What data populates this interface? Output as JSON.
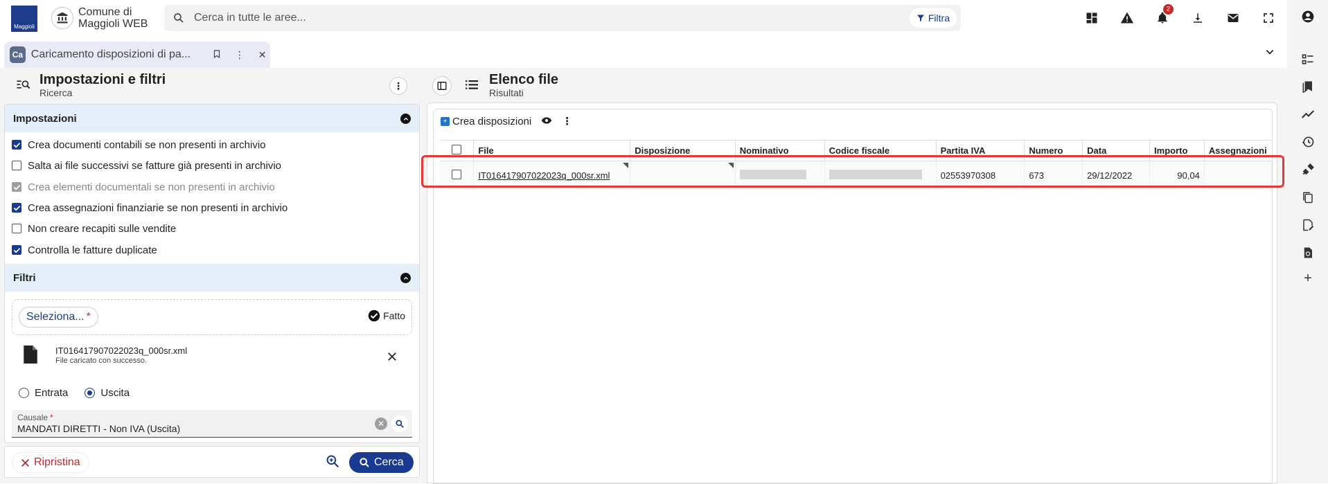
{
  "topbar": {
    "logo_text": "Maggioli",
    "org_name_line1": "Comune di",
    "org_name_line2": "Maggioli WEB",
    "search_placeholder": "Cerca in tutte le aree...",
    "filter_label": "Filtra",
    "notifications_count": "2"
  },
  "tab": {
    "icon_text": "Ca",
    "label": "Caricamento disposizioni di pa..."
  },
  "left": {
    "title": "Impostazioni e filtri",
    "subtitle": "Ricerca",
    "impostazioni": {
      "title": "Impostazioni",
      "options": [
        {
          "label": "Crea documenti contabili se non presenti in archivio",
          "checked": true,
          "disabled": false
        },
        {
          "label": "Salta ai file successivi se fatture già presenti in archivio",
          "checked": false,
          "disabled": false
        },
        {
          "label": "Crea elementi documentali se non presenti in archivio",
          "checked": true,
          "disabled": true
        },
        {
          "label": "Crea assegnazioni finanziarie se non presenti in archivio",
          "checked": true,
          "disabled": false
        },
        {
          "label": "Non creare recapiti sulle vendite",
          "checked": false,
          "disabled": false
        },
        {
          "label": "Controlla le fatture duplicate",
          "checked": true,
          "disabled": false
        }
      ]
    },
    "filtri": {
      "title": "Filtri",
      "select_label": "Seleziona...",
      "required_mark": "*",
      "done_label": "Fatto",
      "file_name": "IT016417907022023q_000sr.xml",
      "file_status": "File caricato con successo.",
      "radio_entrata": "Entrata",
      "radio_uscita": "Uscita",
      "selected_radio": "uscita",
      "causale_label": "Causale",
      "causale_value": "MANDATI DIRETTI - Non IVA (Uscita)"
    },
    "footer": {
      "reset_label": "Ripristina",
      "search_label": "Cerca"
    }
  },
  "right": {
    "title": "Elenco file",
    "subtitle": "Risultati",
    "toolbar": {
      "create_label": "Crea disposizioni"
    },
    "columns": [
      "File",
      "Disposizione",
      "Nominativo",
      "Codice fiscale",
      "Partita IVA",
      "Numero",
      "Data",
      "Importo",
      "Assegnazioni"
    ],
    "rows": [
      {
        "file": "IT016417907022023q_000sr.xml",
        "disposizione": "",
        "nominativo": "",
        "codice_fiscale": "",
        "partita_iva": "02553970308",
        "numero": "673",
        "data": "29/12/2022",
        "importo": "90,04",
        "assegnazioni": ""
      }
    ]
  },
  "colors": {
    "primary": "#1a3a8f",
    "section_header_bg": "#e3eef9",
    "highlight": "#e53935",
    "danger": "#c62828"
  }
}
